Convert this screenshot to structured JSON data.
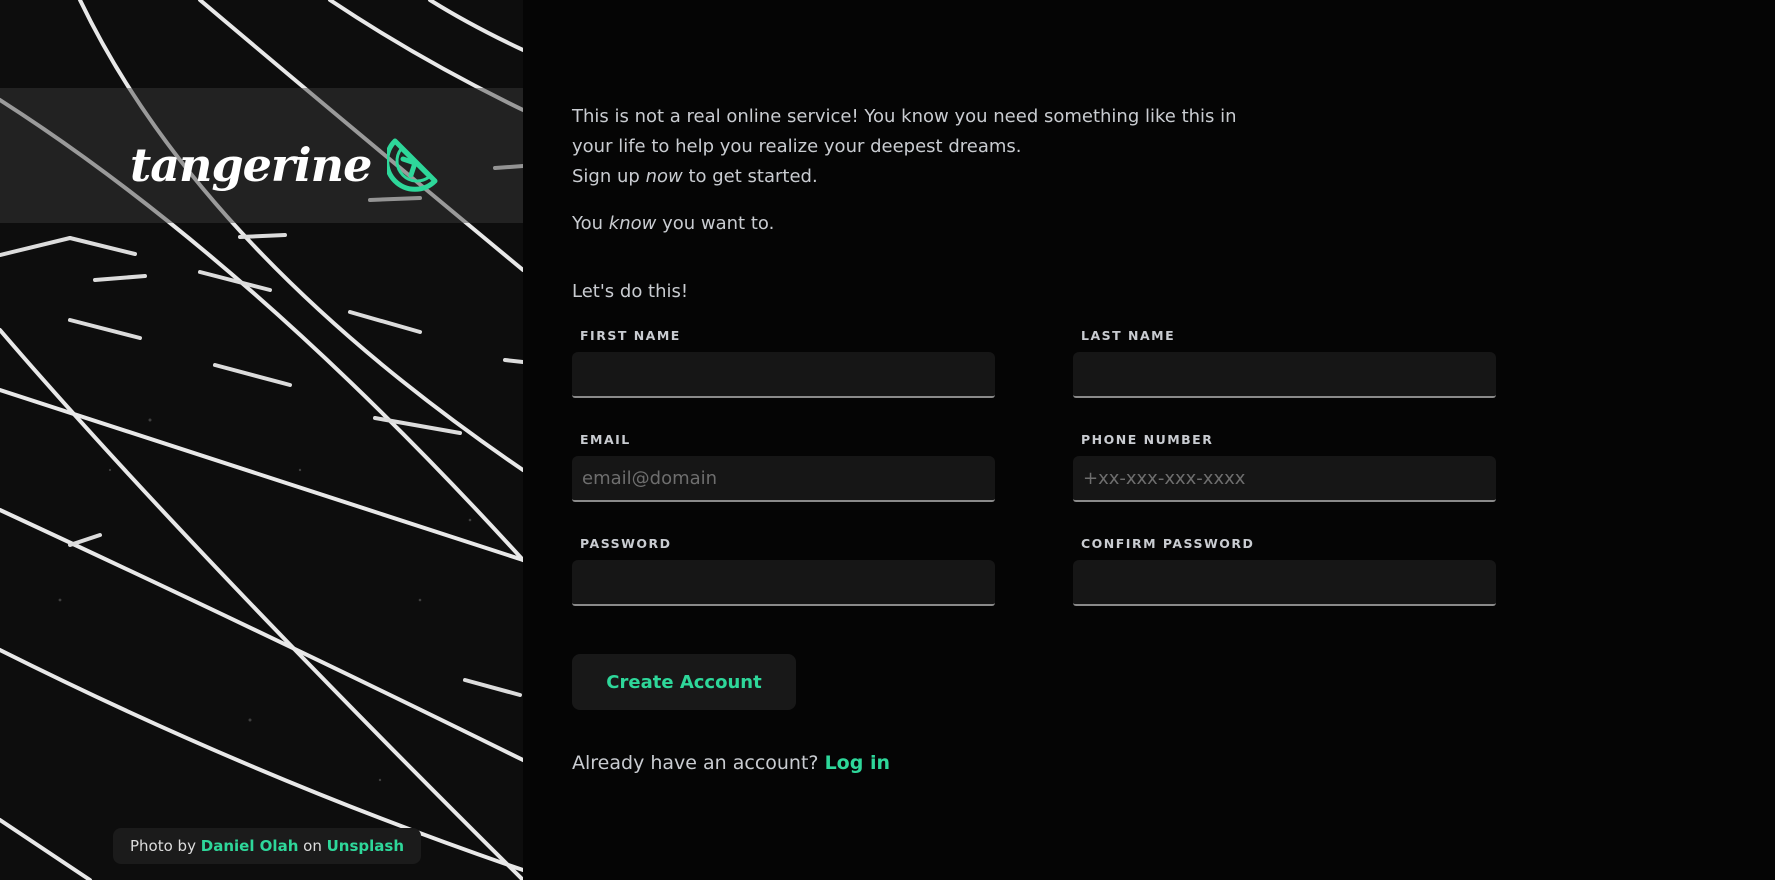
{
  "brand": {
    "name": "tangerine",
    "logo_icon": "tangerine-slice-icon",
    "accent": "#2ed79a"
  },
  "photo_credit": {
    "prefix": "Photo by",
    "author": "Daniel Olah",
    "middle": "on",
    "source": "Unsplash"
  },
  "intro": {
    "line1": "This is not a real online service! You know you need something like this in",
    "line2": "your life to help you realize your deepest dreams.",
    "line3_start": "Sign up",
    "line3_em": "now",
    "line3_end": "to get started.",
    "line4_start": "You",
    "line4_em": "know",
    "line4_end": "you want to."
  },
  "form": {
    "heading": "Let's do this!",
    "first_name": {
      "label": "FIRST NAME",
      "placeholder": ""
    },
    "last_name": {
      "label": "LAST NAME",
      "placeholder": ""
    },
    "email": {
      "label": "EMAIL",
      "placeholder": "email@domain"
    },
    "phone": {
      "label": "PHONE NUMBER",
      "placeholder": "+xx-xxx-xxx-xxxx"
    },
    "password": {
      "label": "PASSWORD",
      "placeholder": ""
    },
    "confirm_password": {
      "label": "CONFIRM PASSWORD",
      "placeholder": ""
    },
    "submit_label": "Create Account"
  },
  "login": {
    "prompt": "Already have an account?",
    "link": "Log in"
  }
}
